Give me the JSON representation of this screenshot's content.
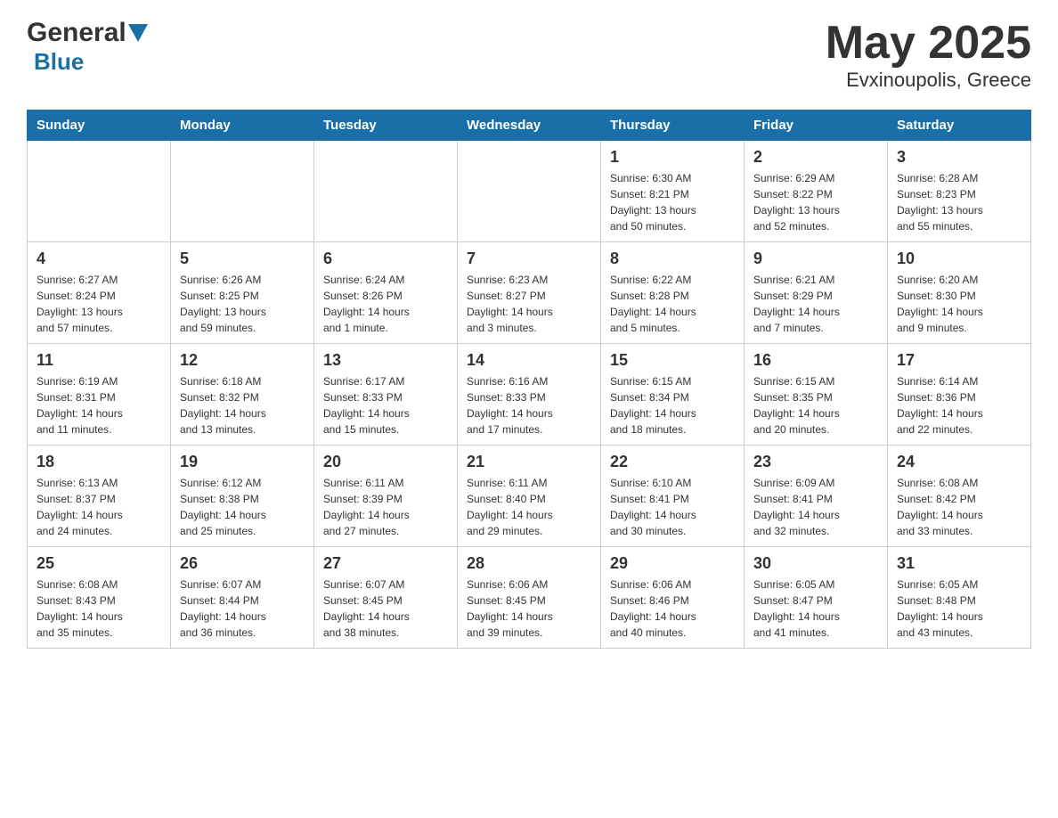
{
  "header": {
    "logo_general": "General",
    "logo_blue": "Blue",
    "month_year": "May 2025",
    "location": "Evxinoupolis, Greece"
  },
  "weekdays": [
    "Sunday",
    "Monday",
    "Tuesday",
    "Wednesday",
    "Thursday",
    "Friday",
    "Saturday"
  ],
  "weeks": [
    [
      {
        "day": "",
        "info": ""
      },
      {
        "day": "",
        "info": ""
      },
      {
        "day": "",
        "info": ""
      },
      {
        "day": "",
        "info": ""
      },
      {
        "day": "1",
        "info": "Sunrise: 6:30 AM\nSunset: 8:21 PM\nDaylight: 13 hours\nand 50 minutes."
      },
      {
        "day": "2",
        "info": "Sunrise: 6:29 AM\nSunset: 8:22 PM\nDaylight: 13 hours\nand 52 minutes."
      },
      {
        "day": "3",
        "info": "Sunrise: 6:28 AM\nSunset: 8:23 PM\nDaylight: 13 hours\nand 55 minutes."
      }
    ],
    [
      {
        "day": "4",
        "info": "Sunrise: 6:27 AM\nSunset: 8:24 PM\nDaylight: 13 hours\nand 57 minutes."
      },
      {
        "day": "5",
        "info": "Sunrise: 6:26 AM\nSunset: 8:25 PM\nDaylight: 13 hours\nand 59 minutes."
      },
      {
        "day": "6",
        "info": "Sunrise: 6:24 AM\nSunset: 8:26 PM\nDaylight: 14 hours\nand 1 minute."
      },
      {
        "day": "7",
        "info": "Sunrise: 6:23 AM\nSunset: 8:27 PM\nDaylight: 14 hours\nand 3 minutes."
      },
      {
        "day": "8",
        "info": "Sunrise: 6:22 AM\nSunset: 8:28 PM\nDaylight: 14 hours\nand 5 minutes."
      },
      {
        "day": "9",
        "info": "Sunrise: 6:21 AM\nSunset: 8:29 PM\nDaylight: 14 hours\nand 7 minutes."
      },
      {
        "day": "10",
        "info": "Sunrise: 6:20 AM\nSunset: 8:30 PM\nDaylight: 14 hours\nand 9 minutes."
      }
    ],
    [
      {
        "day": "11",
        "info": "Sunrise: 6:19 AM\nSunset: 8:31 PM\nDaylight: 14 hours\nand 11 minutes."
      },
      {
        "day": "12",
        "info": "Sunrise: 6:18 AM\nSunset: 8:32 PM\nDaylight: 14 hours\nand 13 minutes."
      },
      {
        "day": "13",
        "info": "Sunrise: 6:17 AM\nSunset: 8:33 PM\nDaylight: 14 hours\nand 15 minutes."
      },
      {
        "day": "14",
        "info": "Sunrise: 6:16 AM\nSunset: 8:33 PM\nDaylight: 14 hours\nand 17 minutes."
      },
      {
        "day": "15",
        "info": "Sunrise: 6:15 AM\nSunset: 8:34 PM\nDaylight: 14 hours\nand 18 minutes."
      },
      {
        "day": "16",
        "info": "Sunrise: 6:15 AM\nSunset: 8:35 PM\nDaylight: 14 hours\nand 20 minutes."
      },
      {
        "day": "17",
        "info": "Sunrise: 6:14 AM\nSunset: 8:36 PM\nDaylight: 14 hours\nand 22 minutes."
      }
    ],
    [
      {
        "day": "18",
        "info": "Sunrise: 6:13 AM\nSunset: 8:37 PM\nDaylight: 14 hours\nand 24 minutes."
      },
      {
        "day": "19",
        "info": "Sunrise: 6:12 AM\nSunset: 8:38 PM\nDaylight: 14 hours\nand 25 minutes."
      },
      {
        "day": "20",
        "info": "Sunrise: 6:11 AM\nSunset: 8:39 PM\nDaylight: 14 hours\nand 27 minutes."
      },
      {
        "day": "21",
        "info": "Sunrise: 6:11 AM\nSunset: 8:40 PM\nDaylight: 14 hours\nand 29 minutes."
      },
      {
        "day": "22",
        "info": "Sunrise: 6:10 AM\nSunset: 8:41 PM\nDaylight: 14 hours\nand 30 minutes."
      },
      {
        "day": "23",
        "info": "Sunrise: 6:09 AM\nSunset: 8:41 PM\nDaylight: 14 hours\nand 32 minutes."
      },
      {
        "day": "24",
        "info": "Sunrise: 6:08 AM\nSunset: 8:42 PM\nDaylight: 14 hours\nand 33 minutes."
      }
    ],
    [
      {
        "day": "25",
        "info": "Sunrise: 6:08 AM\nSunset: 8:43 PM\nDaylight: 14 hours\nand 35 minutes."
      },
      {
        "day": "26",
        "info": "Sunrise: 6:07 AM\nSunset: 8:44 PM\nDaylight: 14 hours\nand 36 minutes."
      },
      {
        "day": "27",
        "info": "Sunrise: 6:07 AM\nSunset: 8:45 PM\nDaylight: 14 hours\nand 38 minutes."
      },
      {
        "day": "28",
        "info": "Sunrise: 6:06 AM\nSunset: 8:45 PM\nDaylight: 14 hours\nand 39 minutes."
      },
      {
        "day": "29",
        "info": "Sunrise: 6:06 AM\nSunset: 8:46 PM\nDaylight: 14 hours\nand 40 minutes."
      },
      {
        "day": "30",
        "info": "Sunrise: 6:05 AM\nSunset: 8:47 PM\nDaylight: 14 hours\nand 41 minutes."
      },
      {
        "day": "31",
        "info": "Sunrise: 6:05 AM\nSunset: 8:48 PM\nDaylight: 14 hours\nand 43 minutes."
      }
    ]
  ]
}
